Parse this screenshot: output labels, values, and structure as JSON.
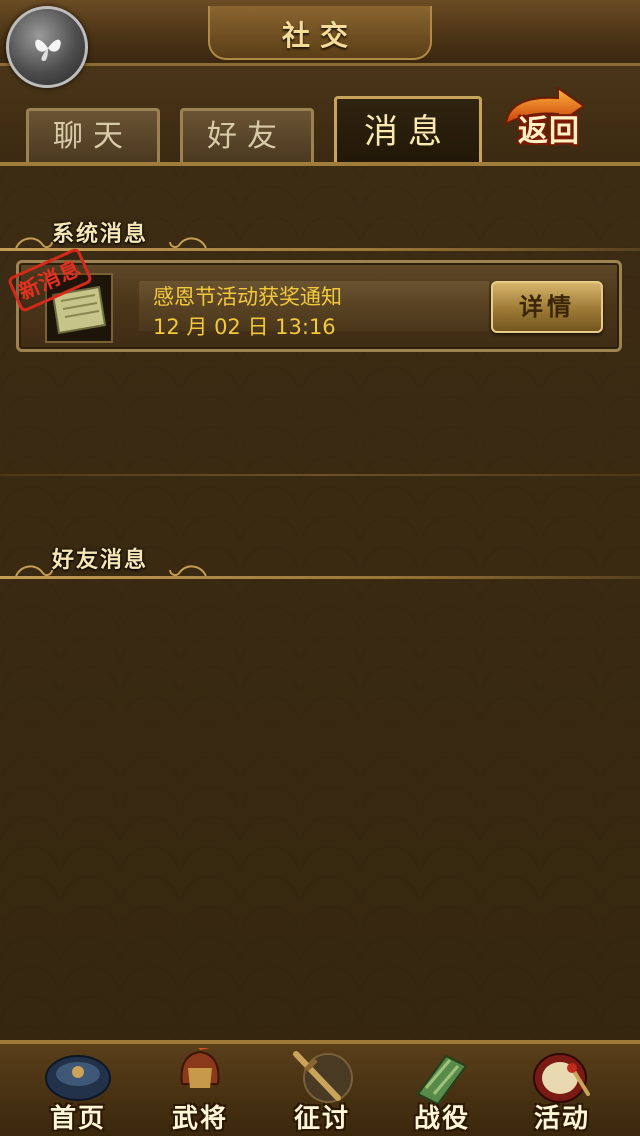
{
  "header": {
    "title": "社交"
  },
  "tabs": [
    {
      "label": "聊天",
      "active": false
    },
    {
      "label": "好友",
      "active": false
    },
    {
      "label": "消息",
      "active": true
    }
  ],
  "back": {
    "label": "返回"
  },
  "system_section": {
    "title": "系统消息",
    "messages": [
      {
        "badge": "新消息",
        "icon": "scroll-icon",
        "title": "感恩节活动获奖通知",
        "time": "12 月 02 日 13:16",
        "button": "详情"
      }
    ]
  },
  "friend_section": {
    "title": "好友消息"
  },
  "bottom_nav": [
    {
      "label": "首页",
      "icon": "palace-icon"
    },
    {
      "label": "武将",
      "icon": "general-icon"
    },
    {
      "label": "征讨",
      "icon": "sword-icon"
    },
    {
      "label": "战役",
      "icon": "scroll-map-icon"
    },
    {
      "label": "活动",
      "icon": "drum-icon"
    }
  ],
  "colors": {
    "accent": "#f2c93c",
    "title": "#f7e6b5",
    "stamp": "#d52a1b"
  }
}
